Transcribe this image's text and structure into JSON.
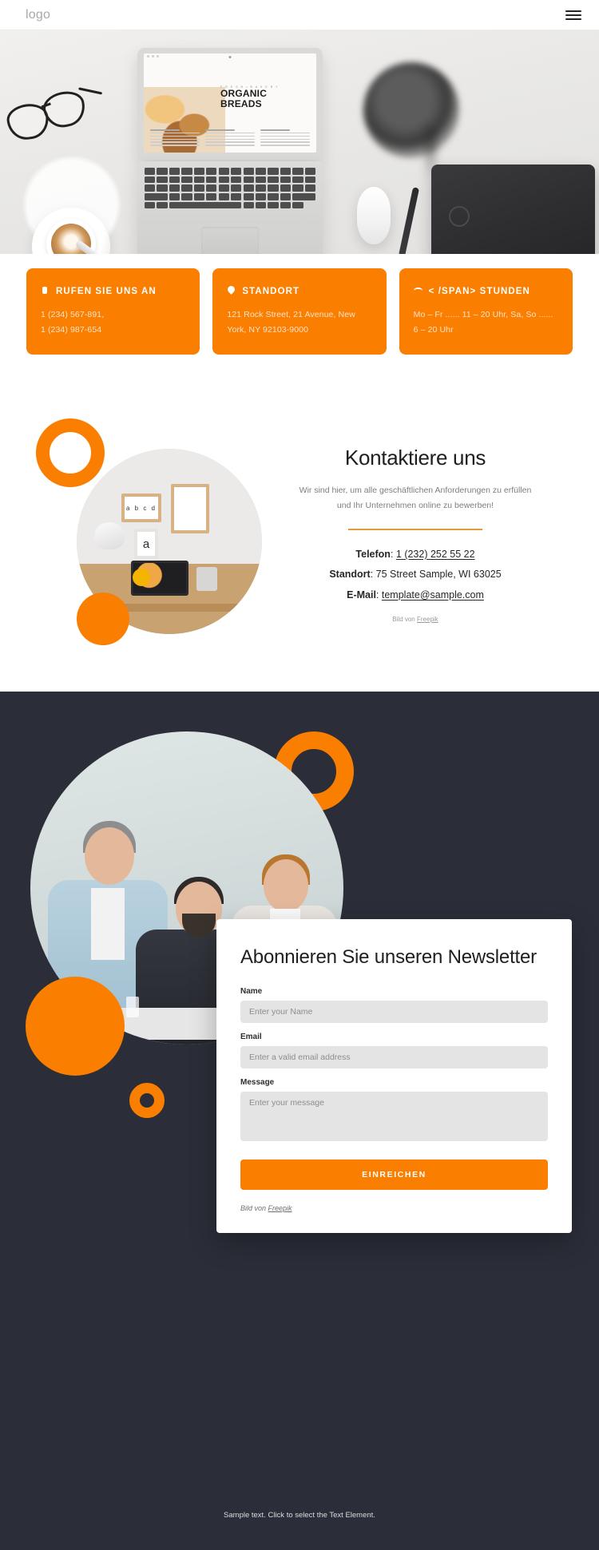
{
  "header": {
    "logo": "logo",
    "menu_icon": "hamburger-menu-icon"
  },
  "hero": {
    "laptop_screen": {
      "kicker": "F R E S H   •   B A K E R Y",
      "title_line1": "ORGANIC",
      "title_line2": "BREADS"
    }
  },
  "info_cards": [
    {
      "icon": "phone-icon",
      "title": "RUFEN SIE UNS AN",
      "body": "1 (234) 567-891,\n1 (234) 987-654"
    },
    {
      "icon": "location-pin-icon",
      "title": "STANDORT",
      "body": "121 Rock Street, 21 Avenue, New York, NY 92103-9000"
    },
    {
      "icon": "clock-icon",
      "title": "< /SPAN> STUNDEN",
      "body": "Mo – Fr ...... 11 – 20 Uhr, Sa, So  ...... 6 – 20 Uhr"
    }
  ],
  "contact": {
    "title": "Kontaktiere uns",
    "subtitle": "Wir sind hier, um alle geschäftlichen Anforderungen zu erfüllen und Ihr Unternehmen online zu bewerben!",
    "phone_label": "Telefon",
    "phone_value": "1 (232) 252 55 22",
    "location_label": "Standort",
    "location_value": "75 Street Sample, WI 63025",
    "email_label": "E-Mail",
    "email_value": "template@sample.com",
    "credit_prefix": "Bild von",
    "credit_link": "Freepik"
  },
  "newsletter": {
    "title": "Abonnieren Sie unseren Newsletter",
    "fields": [
      {
        "label": "Name",
        "placeholder": "Enter your Name",
        "value": ""
      },
      {
        "label": "Email",
        "placeholder": "Enter a valid email address",
        "value": ""
      },
      {
        "label": "Message",
        "placeholder": "Enter your message",
        "value": ""
      }
    ],
    "submit_label": "EINREICHEN",
    "credit_prefix": "Bild von",
    "credit_link": "Freepik"
  },
  "footer": {
    "text": "Sample text. Click to select the Text Element."
  },
  "colors": {
    "accent_orange": "#fa7e00",
    "dark_bg": "#2b2e38",
    "divider_gold": "#e39b3a"
  }
}
